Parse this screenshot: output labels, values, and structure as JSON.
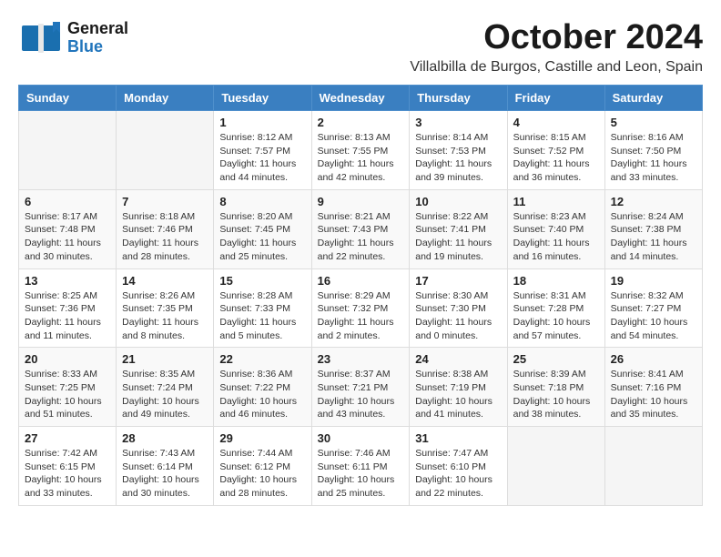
{
  "header": {
    "logo_general": "General",
    "logo_blue": "Blue",
    "month_title": "October 2024",
    "location": "Villalbilla de Burgos, Castille and Leon, Spain"
  },
  "weekdays": [
    "Sunday",
    "Monday",
    "Tuesday",
    "Wednesday",
    "Thursday",
    "Friday",
    "Saturday"
  ],
  "weeks": [
    [
      {
        "day": "",
        "info": ""
      },
      {
        "day": "",
        "info": ""
      },
      {
        "day": "1",
        "info": "Sunrise: 8:12 AM\nSunset: 7:57 PM\nDaylight: 11 hours and 44 minutes."
      },
      {
        "day": "2",
        "info": "Sunrise: 8:13 AM\nSunset: 7:55 PM\nDaylight: 11 hours and 42 minutes."
      },
      {
        "day": "3",
        "info": "Sunrise: 8:14 AM\nSunset: 7:53 PM\nDaylight: 11 hours and 39 minutes."
      },
      {
        "day": "4",
        "info": "Sunrise: 8:15 AM\nSunset: 7:52 PM\nDaylight: 11 hours and 36 minutes."
      },
      {
        "day": "5",
        "info": "Sunrise: 8:16 AM\nSunset: 7:50 PM\nDaylight: 11 hours and 33 minutes."
      }
    ],
    [
      {
        "day": "6",
        "info": "Sunrise: 8:17 AM\nSunset: 7:48 PM\nDaylight: 11 hours and 30 minutes."
      },
      {
        "day": "7",
        "info": "Sunrise: 8:18 AM\nSunset: 7:46 PM\nDaylight: 11 hours and 28 minutes."
      },
      {
        "day": "8",
        "info": "Sunrise: 8:20 AM\nSunset: 7:45 PM\nDaylight: 11 hours and 25 minutes."
      },
      {
        "day": "9",
        "info": "Sunrise: 8:21 AM\nSunset: 7:43 PM\nDaylight: 11 hours and 22 minutes."
      },
      {
        "day": "10",
        "info": "Sunrise: 8:22 AM\nSunset: 7:41 PM\nDaylight: 11 hours and 19 minutes."
      },
      {
        "day": "11",
        "info": "Sunrise: 8:23 AM\nSunset: 7:40 PM\nDaylight: 11 hours and 16 minutes."
      },
      {
        "day": "12",
        "info": "Sunrise: 8:24 AM\nSunset: 7:38 PM\nDaylight: 11 hours and 14 minutes."
      }
    ],
    [
      {
        "day": "13",
        "info": "Sunrise: 8:25 AM\nSunset: 7:36 PM\nDaylight: 11 hours and 11 minutes."
      },
      {
        "day": "14",
        "info": "Sunrise: 8:26 AM\nSunset: 7:35 PM\nDaylight: 11 hours and 8 minutes."
      },
      {
        "day": "15",
        "info": "Sunrise: 8:28 AM\nSunset: 7:33 PM\nDaylight: 11 hours and 5 minutes."
      },
      {
        "day": "16",
        "info": "Sunrise: 8:29 AM\nSunset: 7:32 PM\nDaylight: 11 hours and 2 minutes."
      },
      {
        "day": "17",
        "info": "Sunrise: 8:30 AM\nSunset: 7:30 PM\nDaylight: 11 hours and 0 minutes."
      },
      {
        "day": "18",
        "info": "Sunrise: 8:31 AM\nSunset: 7:28 PM\nDaylight: 10 hours and 57 minutes."
      },
      {
        "day": "19",
        "info": "Sunrise: 8:32 AM\nSunset: 7:27 PM\nDaylight: 10 hours and 54 minutes."
      }
    ],
    [
      {
        "day": "20",
        "info": "Sunrise: 8:33 AM\nSunset: 7:25 PM\nDaylight: 10 hours and 51 minutes."
      },
      {
        "day": "21",
        "info": "Sunrise: 8:35 AM\nSunset: 7:24 PM\nDaylight: 10 hours and 49 minutes."
      },
      {
        "day": "22",
        "info": "Sunrise: 8:36 AM\nSunset: 7:22 PM\nDaylight: 10 hours and 46 minutes."
      },
      {
        "day": "23",
        "info": "Sunrise: 8:37 AM\nSunset: 7:21 PM\nDaylight: 10 hours and 43 minutes."
      },
      {
        "day": "24",
        "info": "Sunrise: 8:38 AM\nSunset: 7:19 PM\nDaylight: 10 hours and 41 minutes."
      },
      {
        "day": "25",
        "info": "Sunrise: 8:39 AM\nSunset: 7:18 PM\nDaylight: 10 hours and 38 minutes."
      },
      {
        "day": "26",
        "info": "Sunrise: 8:41 AM\nSunset: 7:16 PM\nDaylight: 10 hours and 35 minutes."
      }
    ],
    [
      {
        "day": "27",
        "info": "Sunrise: 7:42 AM\nSunset: 6:15 PM\nDaylight: 10 hours and 33 minutes."
      },
      {
        "day": "28",
        "info": "Sunrise: 7:43 AM\nSunset: 6:14 PM\nDaylight: 10 hours and 30 minutes."
      },
      {
        "day": "29",
        "info": "Sunrise: 7:44 AM\nSunset: 6:12 PM\nDaylight: 10 hours and 28 minutes."
      },
      {
        "day": "30",
        "info": "Sunrise: 7:46 AM\nSunset: 6:11 PM\nDaylight: 10 hours and 25 minutes."
      },
      {
        "day": "31",
        "info": "Sunrise: 7:47 AM\nSunset: 6:10 PM\nDaylight: 10 hours and 22 minutes."
      },
      {
        "day": "",
        "info": ""
      },
      {
        "day": "",
        "info": ""
      }
    ]
  ]
}
